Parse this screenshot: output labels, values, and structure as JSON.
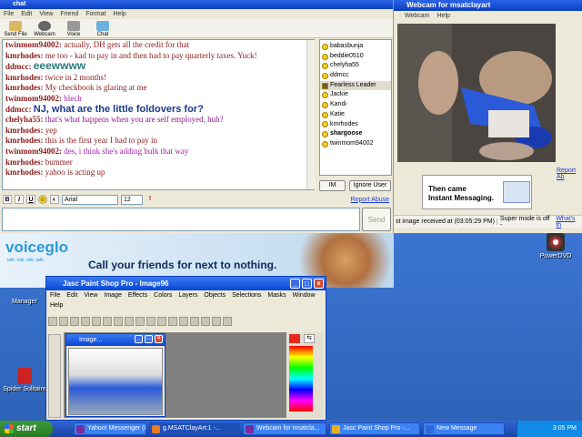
{
  "chat_window": {
    "title": "chat",
    "menu": [
      "File",
      "Edit",
      "View",
      "Friend",
      "Format",
      "Help"
    ],
    "toolbar": [
      "Send File",
      "Webcam",
      "Voice",
      "Chat"
    ],
    "messages": [
      {
        "who": "twinmom94002:",
        "text": "actually, DH gets all the credit for that",
        "style": "m"
      },
      {
        "who": "kmrhodes:",
        "text": "me too - kad to pay in and then had to pay quarterly taxes. Yuck!",
        "style": "m"
      },
      {
        "who": "ddmcc:",
        "text": "eeewwww",
        "style": "big"
      },
      {
        "who": "kmrhodes:",
        "text": "twice in 2 months!",
        "style": "m"
      },
      {
        "who": "kmrhodes:",
        "text": "My checkbook is glaring at me",
        "style": "m"
      },
      {
        "who": "twinmom94002:",
        "text": "blech",
        "style": "p"
      },
      {
        "who": "ddmcc:",
        "text": "NJ, what are the little foldovers for?",
        "style": "big2"
      },
      {
        "who": "chelyha55:",
        "text": "that's what happens when you are self employed, huh?",
        "style": "ch"
      },
      {
        "who": "kmrhodes:",
        "text": "yep",
        "style": "m"
      },
      {
        "who": "kmrhodes:",
        "text": "this is the first year I had to pay in",
        "style": "m"
      },
      {
        "who": "twinmom94002:",
        "text": "des, i think she's adding bulk that way",
        "style": "p"
      },
      {
        "who": "kmrhodes:",
        "text": "bummer",
        "style": "m"
      },
      {
        "who": "kmrhodes:",
        "text": "yahoo is acting up",
        "style": "m"
      }
    ],
    "buddies": [
      {
        "name": "babasbunja",
        "bold": false,
        "selected": false
      },
      {
        "name": "beddie0510",
        "bold": false,
        "selected": false
      },
      {
        "name": "chelyha55",
        "bold": false,
        "selected": false
      },
      {
        "name": "ddmcc",
        "bold": false,
        "selected": false
      },
      {
        "name": "Fearless Leader",
        "bold": false,
        "selected": true
      },
      {
        "name": "Jackie",
        "bold": false,
        "selected": false
      },
      {
        "name": "Kandi",
        "bold": false,
        "selected": false
      },
      {
        "name": "Katie",
        "bold": false,
        "selected": false
      },
      {
        "name": "kmrhodes",
        "bold": false,
        "selected": false
      },
      {
        "name": "shargoose",
        "bold": true,
        "selected": false
      },
      {
        "name": "twinmom94002",
        "bold": false,
        "selected": false
      }
    ],
    "im_label": "IM",
    "ignore_label": "Ignore User",
    "report_abuse": "Report Abuse",
    "font_name": "Arial",
    "font_size": "12",
    "send_label": "Send",
    "ad": {
      "logo": "voiceglo",
      "tagline": "talk. talk. talk. talk.",
      "headline": "Call your friends for next to nothing."
    }
  },
  "webcam_window": {
    "title": "Webcam for msatclayart",
    "menu": [
      "Webcam",
      "Help"
    ],
    "report": "Report Ab",
    "ad_line1": "Then came",
    "ad_line2": "Instant Messaging.",
    "status": "st image received at (03:05:29 PM)",
    "super_mode": "Super mode is off -",
    "whats": "What's th"
  },
  "desktop": {
    "power_dvd": "PowerDVD",
    "manager": "Manager",
    "spider": "Spider Solitaire"
  },
  "psp_window": {
    "title": "Jasc Paint Shop Pro - Image96",
    "menu": [
      "File",
      "Edit",
      "View",
      "Image",
      "Effects",
      "Colors",
      "Layers",
      "Objects",
      "Selections",
      "Masks",
      "Window",
      "Help"
    ],
    "image_title": "Image..."
  },
  "taskbar": {
    "start": "start",
    "tasks": [
      {
        "label": "Yahoo! Messenger (I...",
        "active": false,
        "color": "#7b2a9c"
      },
      {
        "label": "g.MSATClayArt:1 -...",
        "active": true,
        "color": "#e87a20"
      },
      {
        "label": "Webcam for msatcla...",
        "active": false,
        "color": "#7b2a9c"
      },
      {
        "label": "Jasc Paint Shop Pro -...",
        "active": false,
        "color": "#e8b020"
      },
      {
        "label": "New Message",
        "active": false,
        "color": "#2a6ad8"
      }
    ],
    "clock": "3:05 PM"
  }
}
